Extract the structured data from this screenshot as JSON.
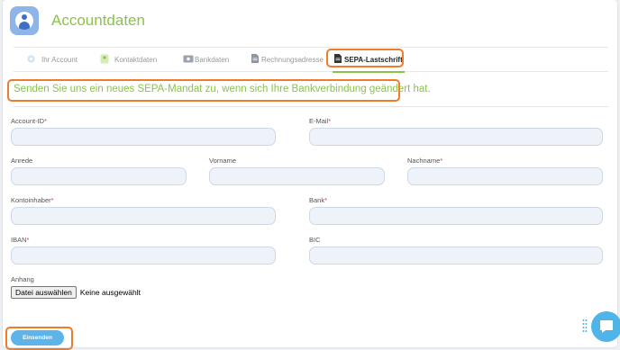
{
  "header": {
    "title": "Accountdaten",
    "avatar_icon": "user-circle-icon"
  },
  "tabs": [
    {
      "label": "Ihr Account",
      "icon": "gear-icon"
    },
    {
      "label": "Kontaktdaten",
      "icon": "contact-card-icon"
    },
    {
      "label": "Bankdaten",
      "icon": "banknote-icon"
    },
    {
      "label": "Rechnungsadresse",
      "icon": "document-icon"
    },
    {
      "label": "SEPA-Lastschrift",
      "icon": "document-icon",
      "active": true
    }
  ],
  "info_text": "Senden Sie uns ein neues SEPA-Mandat zu, wenn sich Ihre Bankverbindung geändert hat.",
  "fields": {
    "account_id": {
      "label": "Account-ID",
      "required": "*",
      "value": ""
    },
    "email": {
      "label": "E-Mail",
      "required": "*",
      "value": ""
    },
    "anrede": {
      "label": "Anrede",
      "value": ""
    },
    "vorname": {
      "label": "Vorname",
      "value": ""
    },
    "nachname": {
      "label": "Nachname",
      "required": "*",
      "value": ""
    },
    "kontoinhaber": {
      "label": "Kontoinhaber",
      "required": "*",
      "value": ""
    },
    "bank": {
      "label": "Bank",
      "required": "*",
      "value": ""
    },
    "iban": {
      "label": "IBAN",
      "required": "*",
      "value": ""
    },
    "bic": {
      "label": "BIC",
      "value": ""
    }
  },
  "attachment": {
    "label": "Anhang",
    "button_label": "Datei auswählen",
    "status": "Keine ausgewählt"
  },
  "submit_label": "Einsenden",
  "colors": {
    "accent": "#8bc34a",
    "highlight": "#f07b2b",
    "button": "#5eb4e8",
    "required": "#e53935"
  }
}
